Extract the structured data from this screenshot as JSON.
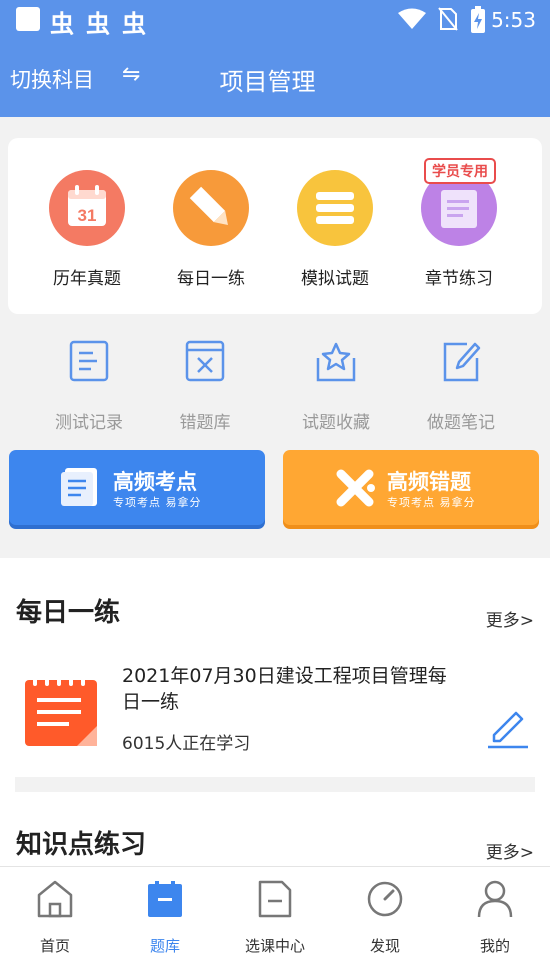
{
  "status_bar": {
    "time": "5:53",
    "app_icons": [
      "虫",
      "虫",
      "虫"
    ]
  },
  "header": {
    "switch_subject": "切换科目",
    "switch_icon": "⇋",
    "title": "项目管理"
  },
  "main_actions": [
    {
      "label": "历年真题",
      "icon": "calendar-icon",
      "color": "#f47a63",
      "calendar_day": "31"
    },
    {
      "label": "每日一练",
      "icon": "pencil-icon",
      "color": "#f79a3a"
    },
    {
      "label": "模拟试题",
      "icon": "stack-icon",
      "color": "#f8c43d"
    },
    {
      "label": "章节练习",
      "icon": "scroll-icon",
      "color": "#bd82e6",
      "badge": "学员专用"
    }
  ],
  "secondary_actions": [
    {
      "label": "测试记录",
      "icon": "record-list-icon"
    },
    {
      "label": "错题库",
      "icon": "wrong-book-icon"
    },
    {
      "label": "试题收藏",
      "icon": "favorite-star-icon"
    },
    {
      "label": "做题笔记",
      "icon": "note-edit-icon"
    }
  ],
  "banners": [
    {
      "title": "高频考点",
      "subtitle": "专项考点  易拿分",
      "color": "#3d86ee"
    },
    {
      "title": "高频错题",
      "subtitle": "专项考点  易拿分",
      "color": "#ffa733"
    }
  ],
  "daily": {
    "section_title": "每日一练",
    "more": "更多>",
    "item_title": "2021年07月30日建设工程项目管理每日一练",
    "learners": "6015人正在学习"
  },
  "knowledge": {
    "section_title": "知识点练习",
    "more": "更多>"
  },
  "bottom_nav": [
    {
      "label": "首页",
      "icon": "home-icon",
      "active": false
    },
    {
      "label": "题库",
      "icon": "question-bank-icon",
      "active": true
    },
    {
      "label": "选课中心",
      "icon": "course-center-icon",
      "active": false
    },
    {
      "label": "发现",
      "icon": "discover-compass-icon",
      "active": false
    },
    {
      "label": "我的",
      "icon": "profile-icon",
      "active": false
    }
  ],
  "colors": {
    "primary": "#5b93ea",
    "accent_blue": "#3d86ee",
    "accent_orange": "#ffa733",
    "badge_red": "#e94c4c"
  }
}
